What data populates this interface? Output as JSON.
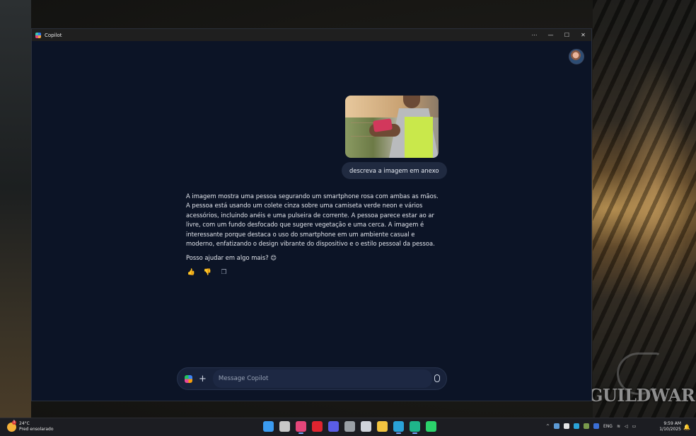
{
  "window": {
    "title": "Copilot",
    "controls": {
      "more": "⋯",
      "minimize": "—",
      "maximize": "☐",
      "close": "✕"
    }
  },
  "chat": {
    "user_message": "descreva a imagem em anexo",
    "assistant_paragraph": "A imagem mostra uma pessoa segurando um smartphone rosa com ambas as mãos. A pessoa está usando um colete cinza sobre uma camiseta verde neon e vários acessórios, incluindo anéis e uma pulseira de corrente. A pessoa parece estar ao ar livre, com um fundo desfocado que sugere vegetação e uma cerca. A imagem é interessante porque destaca o uso do smartphone em um ambiente casual e moderno, enfatizando o design vibrante do dispositivo e o estilo pessoal da pessoa.",
    "assistant_followup": "Posso ajudar em algo mais? 😊",
    "feedback_icons": {
      "like": "👍",
      "dislike": "👎",
      "copy": "❐"
    }
  },
  "composer": {
    "placeholder": "Message Copilot",
    "value": "",
    "plus": "+"
  },
  "wallpaper": {
    "logo_text": "GUILDWARS"
  },
  "taskbar": {
    "weather": {
      "temp": "24°C",
      "condition": "Pred ensolarado",
      "badge": "1"
    },
    "apps": [
      {
        "name": "windows-start",
        "color": "#3b9bf0",
        "active": false
      },
      {
        "name": "file-explorer-window",
        "color": "#c8c8c8",
        "active": false
      },
      {
        "name": "copilot",
        "color": "#e4467a",
        "active": true
      },
      {
        "name": "opera",
        "color": "#e0242f",
        "active": false
      },
      {
        "name": "visual-studio",
        "color": "#5a5de6",
        "active": false
      },
      {
        "name": "obs",
        "color": "#9aa0a6",
        "active": false
      },
      {
        "name": "speedtest",
        "color": "#cfd3da",
        "active": false
      },
      {
        "name": "file-explorer",
        "color": "#f2c440",
        "active": false
      },
      {
        "name": "edge",
        "color": "#2aa3d8",
        "active": true
      },
      {
        "name": "edge-beta",
        "color": "#1fb58a",
        "active": true
      },
      {
        "name": "shield-app",
        "color": "#2bd36b",
        "active": false
      }
    ],
    "tray": {
      "language": "ENG"
    },
    "clock": {
      "time": "9:59 AM",
      "date": "1/10/2025"
    },
    "notification_icon": "🔔"
  }
}
